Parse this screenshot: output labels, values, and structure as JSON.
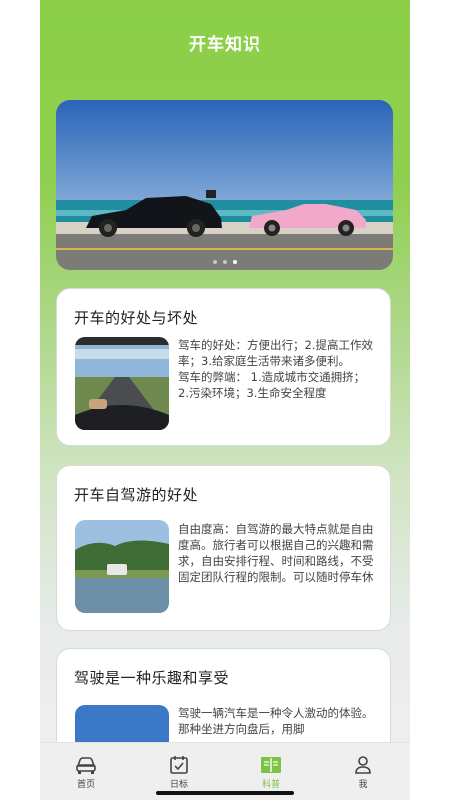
{
  "header": {
    "title": "开车知识"
  },
  "banner": {
    "image": "sports-cars-on-coastal-road",
    "slide_count": 3,
    "active_slide": 3
  },
  "articles": [
    {
      "title": "开车的好处与坏处",
      "image": "driving-on-highway",
      "text": "驾车的好处：方便出行；2.提高工作效率；3.给家庭生活带来诸多便利。\n驾车的弊端： 1.造成城市交通拥挤；2.污染环境；3.生命安全程度"
    },
    {
      "title": "开车自驾游的好处",
      "image": "campervan-by-lake",
      "text": "自由度高：自驾游的最大特点就是自由度高。旅行者可以根据自己的兴趣和需求，自由安排行程、时间和路线，不受固定团队行程的限制。可以随时停车休"
    },
    {
      "title": "驾驶是一种乐趣和享受",
      "image": "blue-sky",
      "text": "驾驶一辆汽车是一种令人激动的体验。那种坐进方向盘后，用脚"
    }
  ],
  "tabbar": {
    "active": "科普",
    "tabs": [
      {
        "label": "首页",
        "icon": "car-icon"
      },
      {
        "label": "日标",
        "icon": "calendar-check-icon"
      },
      {
        "label": "科普",
        "icon": "book-icon"
      },
      {
        "label": "我",
        "icon": "person-icon"
      }
    ],
    "colors": {
      "active": "#7cc243",
      "inactive": "#444444"
    }
  },
  "colors": {
    "header_green": "#8ccf47",
    "accent": "#7cc243"
  }
}
